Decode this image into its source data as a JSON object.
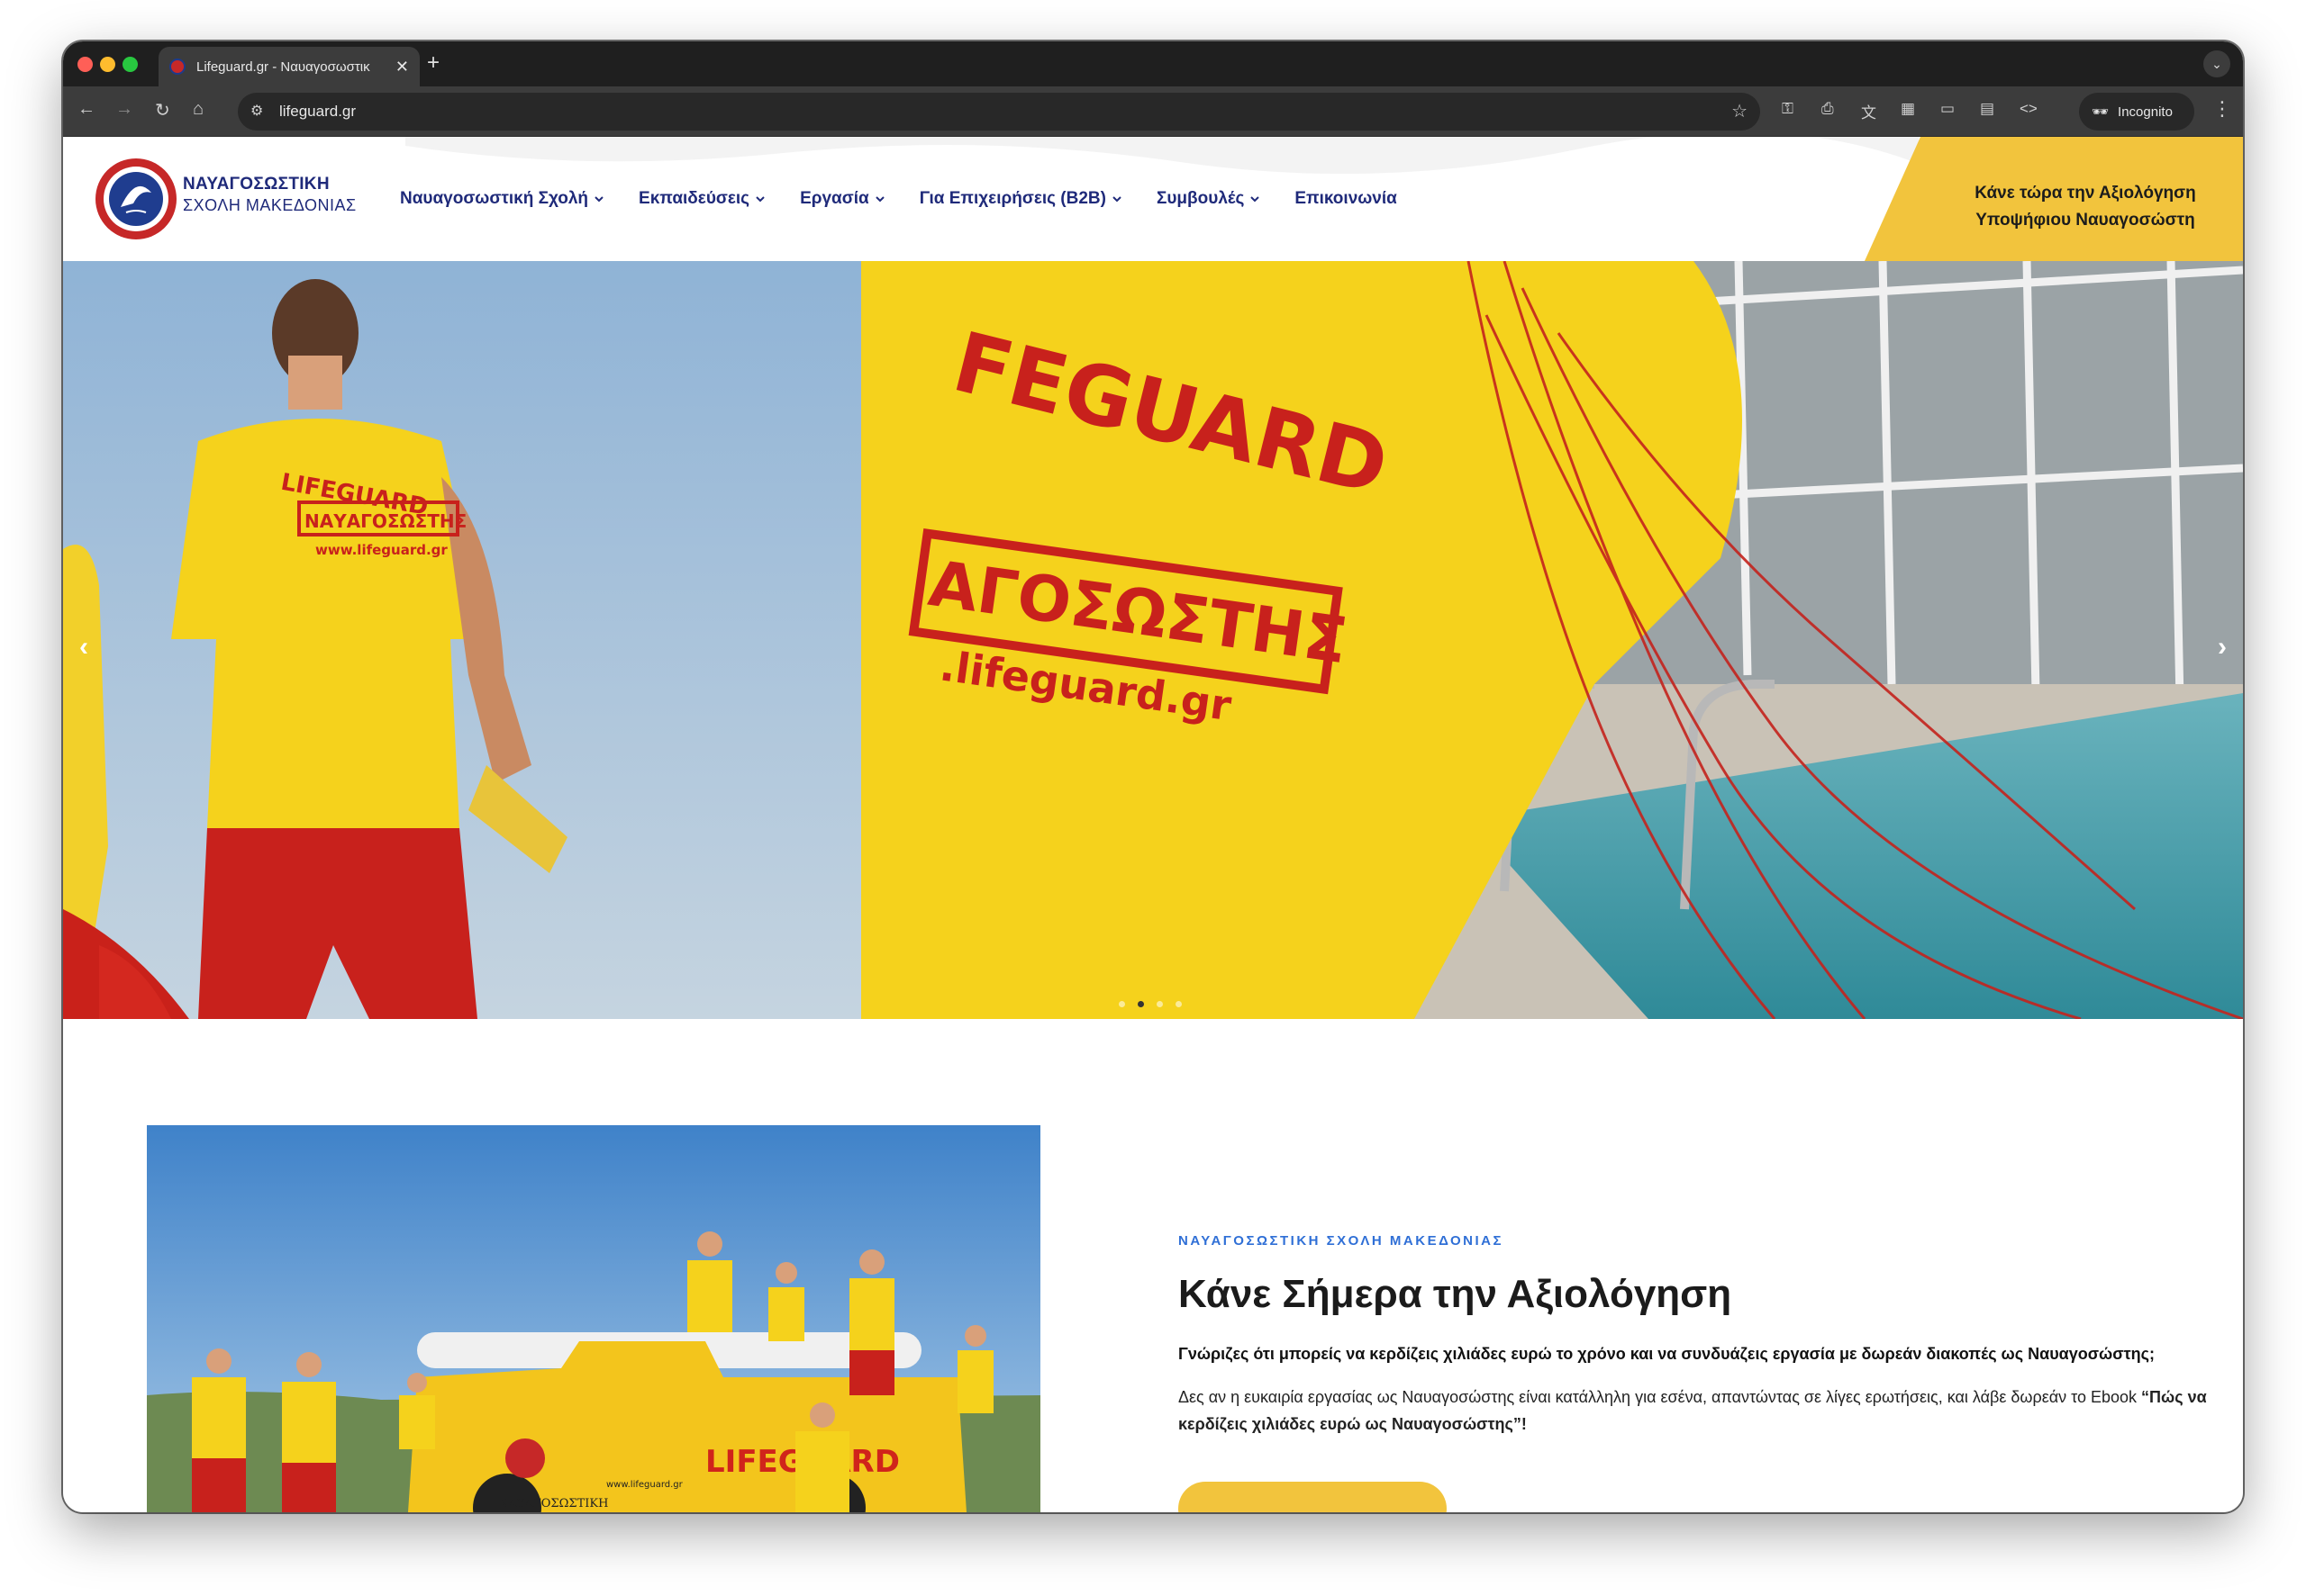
{
  "browser": {
    "tab_title": "Lifeguard.gr - Ναυαγοσωστικ",
    "tab_close": "✕",
    "new_tab": "+",
    "url": "lifeguard.gr",
    "incognito_label": "Incognito"
  },
  "site": {
    "brand_line1": "ΝΑΥΑΓΟΣΩΣΤΙΚΗ",
    "brand_line2": "ΣΧΟΛΗ ΜΑΚΕΔΟΝΙΑΣ",
    "nav": [
      {
        "label": "Ναυαγοσωστική Σχολή"
      },
      {
        "label": "Εκπαιδεύσεις"
      },
      {
        "label": "Εργασία"
      },
      {
        "label": "Για Επιχειρήσεις (B2B)"
      },
      {
        "label": "Συμβουλές"
      },
      {
        "label": "Επικοινωνία"
      }
    ],
    "cta_line1": "Κάνε τώρα την Αξιολόγηση",
    "cta_line2": "Υποψήφιου Ναυαγοσώστη"
  },
  "hero": {
    "shirt_text_left_1": "LIFEGUARD",
    "shirt_text_left_2": "ΝΑΥΑΓΟΣΩΣΤΗΣ",
    "shirt_text_left_3": "www.lifeguard.gr",
    "shirt_text_right_1": "FEGUARD",
    "shirt_text_right_2": "ΑΓΟΣΩΣΤΗΣ",
    "shirt_text_right_3": ".lifeguard.gr",
    "slide_count": 4,
    "active_slide": 2,
    "prev_glyph": "‹",
    "next_glyph": "›"
  },
  "about": {
    "eyebrow": "ΝΑΥΑΓΟΣΩΣΤΙΚΗ ΣΧΟΛΗ ΜΑΚΕΔΟΝΙΑΣ",
    "title": "Κάνε Σήμερα την Αξιολόγηση",
    "p1": "Γνώριζες ότι μπορείς να κερδίζεις χιλιάδες ευρώ το χρόνο και να συνδυάζεις εργασία με δωρεάν διακοπές ως Ναυαγοσώστης;",
    "p2_start": "Δες αν η ευκαιρία εργασίας ως Ναυαγοσώστης είναι κατάλληλη για εσένα, απαντώντας σε λίγες ερωτήσεις, και λάβε δωρεάν το Ebook ",
    "p2_bold": "“Πώς να κερδίζεις χιλιάδες ευρώ ως Ναυαγοσώστης”!",
    "truck_text": "LIFEGUARD",
    "truck_door_line1": "ΝΑΥΑΓΟΣΩΣΤΙΚΗ",
    "truck_door_line2": "www.lifeguard.gr"
  },
  "colors": {
    "brand_blue": "#1f2a7a",
    "cta_yellow": "#f2c43d",
    "eyebrow_blue": "#2f6fd6",
    "shirt_yellow": "#f5d21c",
    "shorts_red": "#c8211c"
  }
}
